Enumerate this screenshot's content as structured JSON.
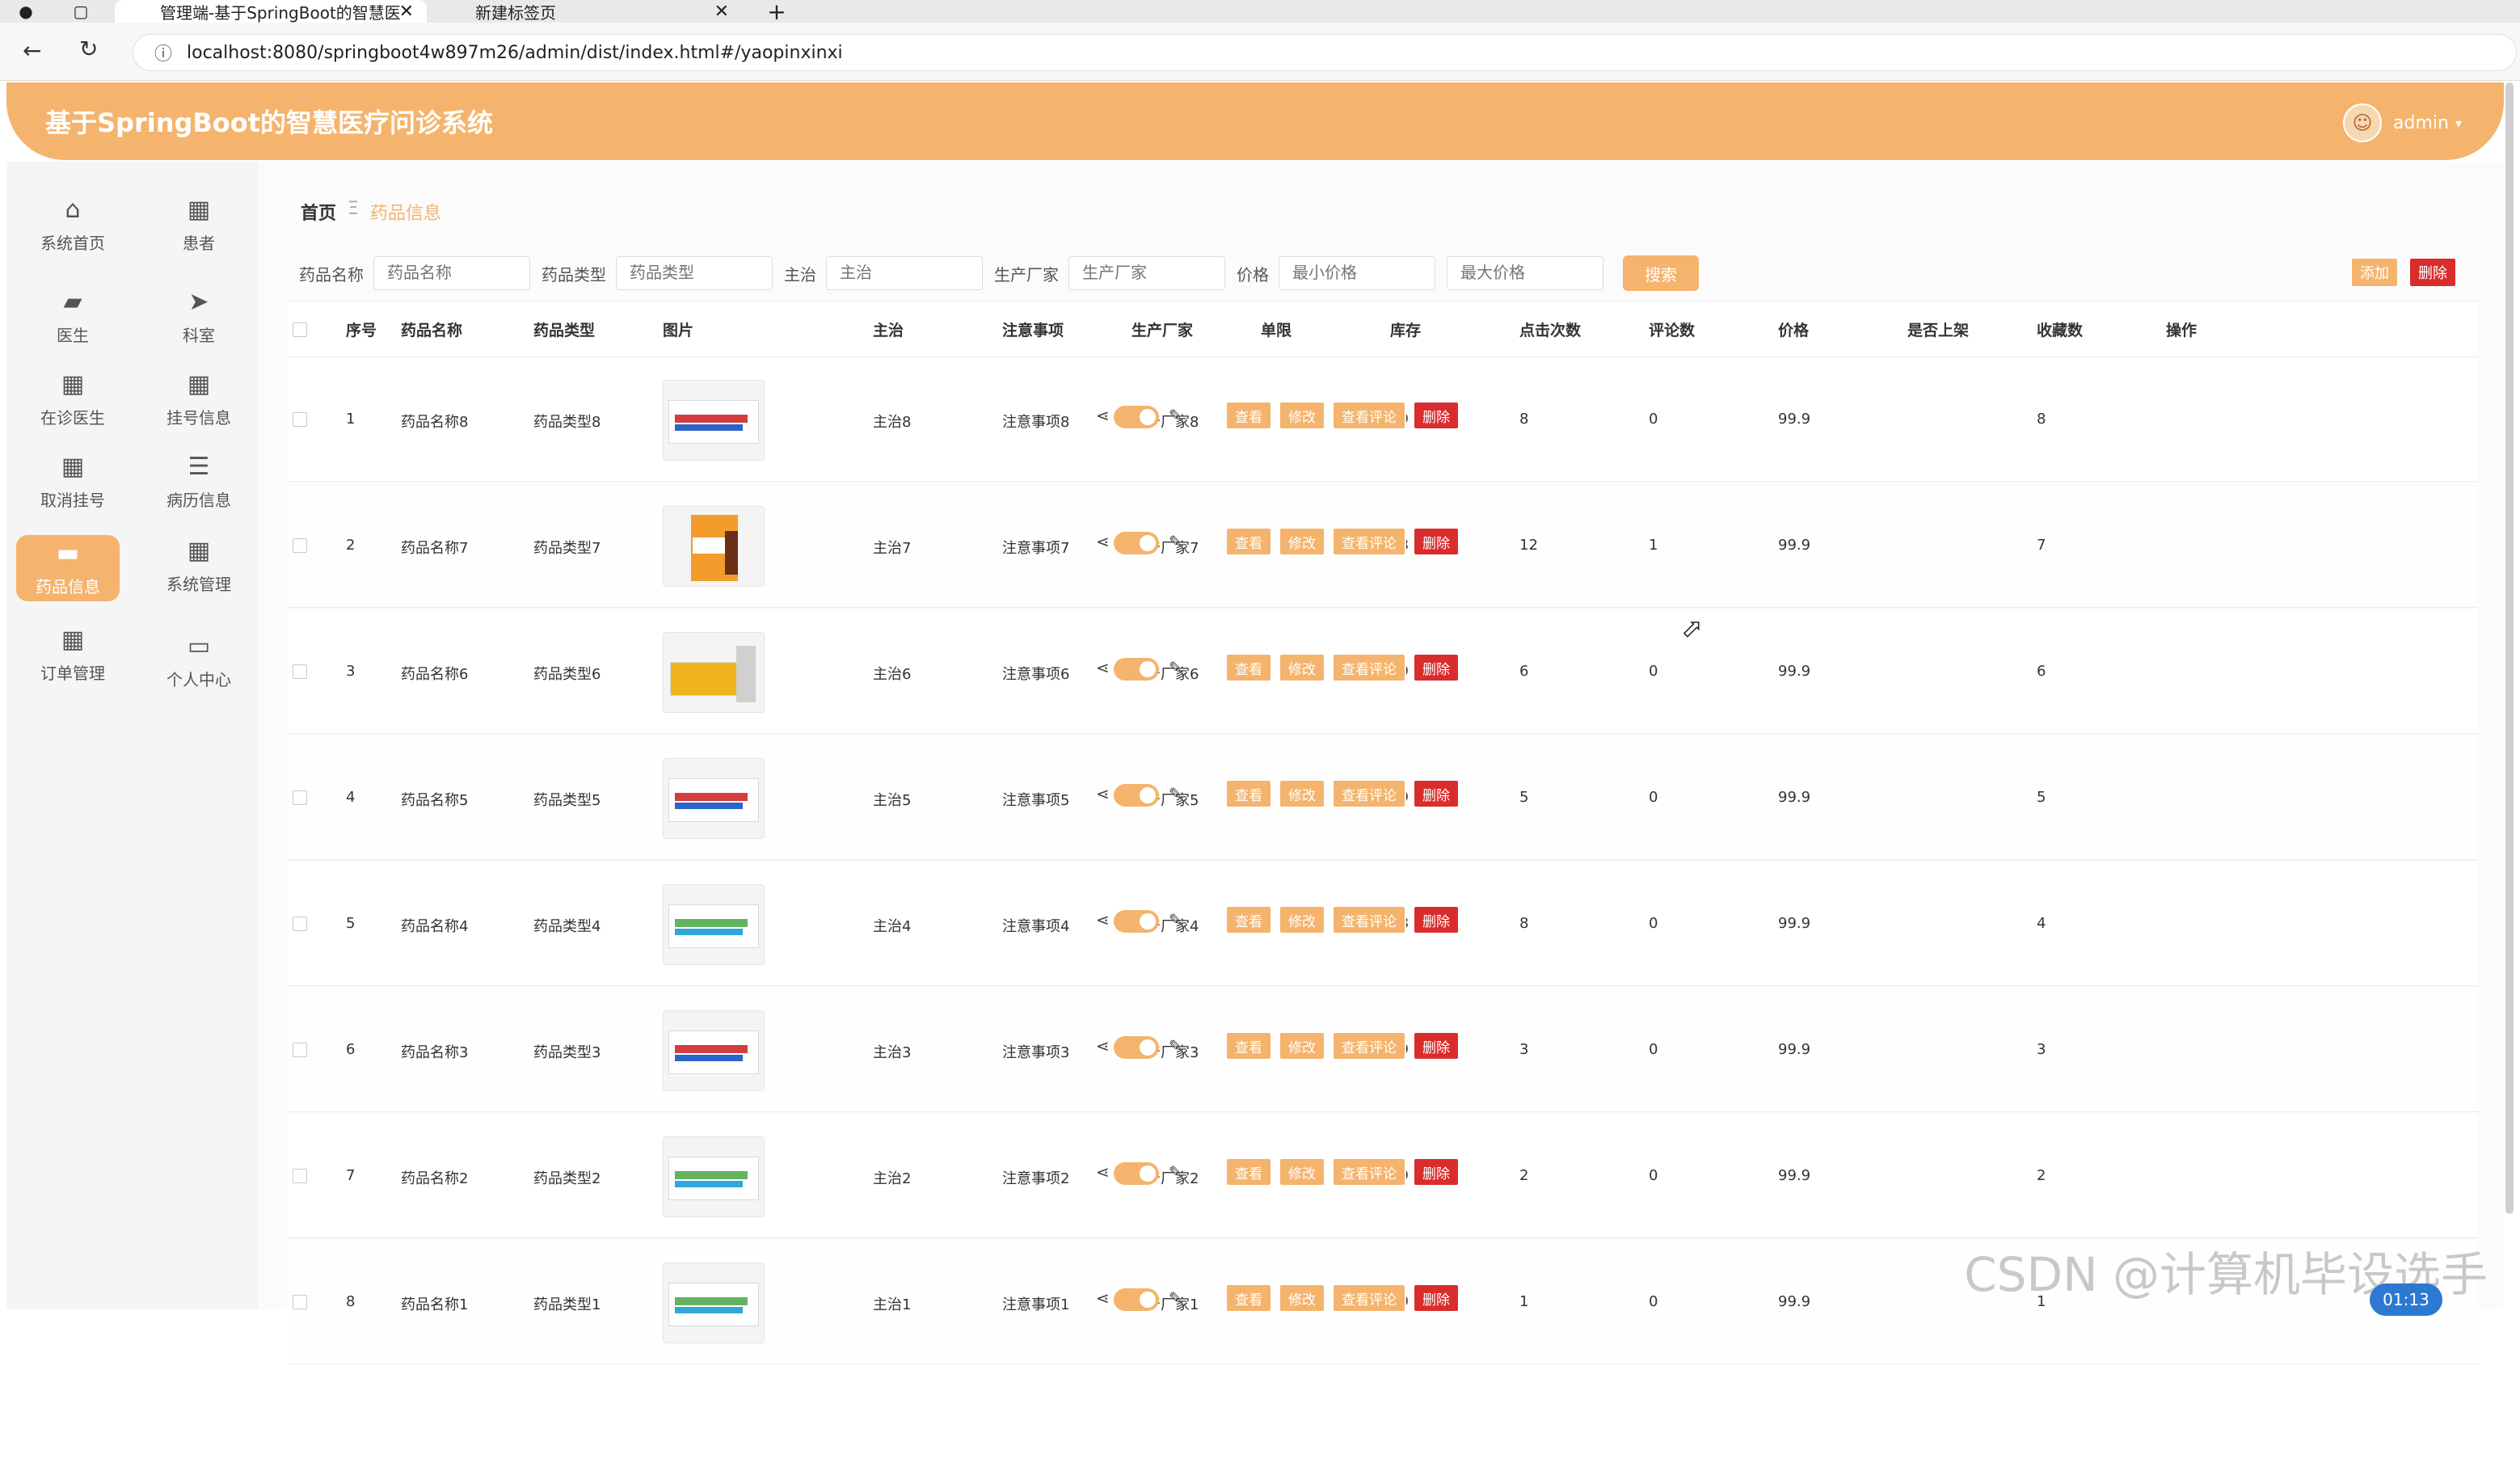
{
  "browser": {
    "tabs": [
      {
        "label": "管理端-基于SpringBoot的智慧医"
      },
      {
        "label": "新建标签页"
      }
    ],
    "url": "localhost:8080/springboot4w897m26/admin/dist/index.html#/yaopinxinxi"
  },
  "header": {
    "title": "基于SpringBoot的智慧医疗问诊系统",
    "user": "admin"
  },
  "sidebar": {
    "items": [
      {
        "label": "系统首页",
        "icon": "home-icon"
      },
      {
        "label": "患者",
        "icon": "grid-icon"
      },
      {
        "label": "医生",
        "icon": "chat-icon"
      },
      {
        "label": "科室",
        "icon": "send-icon"
      },
      {
        "label": "在诊医生",
        "icon": "grid-icon"
      },
      {
        "label": "挂号信息",
        "icon": "grid-icon"
      },
      {
        "label": "取消挂号",
        "icon": "grid-icon"
      },
      {
        "label": "病历信息",
        "icon": "list-icon"
      },
      {
        "label": "药品信息",
        "icon": "monitor-icon"
      },
      {
        "label": "系统管理",
        "icon": "grid-icon"
      },
      {
        "label": "订单管理",
        "icon": "grid-icon"
      },
      {
        "label": "个人中心",
        "icon": "card-icon"
      }
    ]
  },
  "breadcrumb": {
    "home": "首页",
    "separator": "Ξ",
    "current": "药品信息"
  },
  "search": {
    "name_label": "药品名称",
    "name_placeholder": "药品名称",
    "type_label": "药品类型",
    "type_placeholder": "药品类型",
    "main_label": "主治",
    "main_placeholder": "主治",
    "maker_label": "生产厂家",
    "maker_placeholder": "生产厂家",
    "price_label": "价格",
    "min_price_placeholder": "最小价格",
    "max_price_placeholder": "最大价格",
    "search_button": "搜索"
  },
  "top_actions": {
    "add": "添加",
    "delete": "删除"
  },
  "table": {
    "headers": [
      "序号",
      "药品名称",
      "药品类型",
      "图片",
      "主治",
      "注意事项",
      "生产厂家",
      "单限",
      "库存",
      "点击次数",
      "评论数",
      "价格",
      "是否上架",
      "收藏数",
      "操作"
    ],
    "rows": [
      {
        "no": "1",
        "name": "药品名称8",
        "type": "药品类型8",
        "main": "主治8",
        "note": "注意事项8",
        "maker": "生产厂家8",
        "limit": "8",
        "stock": "99",
        "clicks": "8",
        "comments": "0",
        "price": "99.9",
        "fav": "8",
        "img": "box"
      },
      {
        "no": "2",
        "name": "药品名称7",
        "type": "药品类型7",
        "main": "主治7",
        "note": "注意事项7",
        "maker": "生产厂家7",
        "limit": "7",
        "stock": "98",
        "clicks": "12",
        "comments": "1",
        "price": "99.9",
        "fav": "7",
        "img": "bottle"
      },
      {
        "no": "3",
        "name": "药品名称6",
        "type": "药品类型6",
        "main": "主治6",
        "note": "注意事项6",
        "maker": "生产厂家6",
        "limit": "6",
        "stock": "99",
        "clicks": "6",
        "comments": "0",
        "price": "99.9",
        "fav": "6",
        "img": "pill"
      },
      {
        "no": "4",
        "name": "药品名称5",
        "type": "药品类型5",
        "main": "主治5",
        "note": "注意事项5",
        "maker": "生产厂家5",
        "limit": "5",
        "stock": "99",
        "clicks": "5",
        "comments": "0",
        "price": "99.9",
        "fav": "5",
        "img": "box"
      },
      {
        "no": "5",
        "name": "药品名称4",
        "type": "药品类型4",
        "main": "主治4",
        "note": "注意事项4",
        "maker": "生产厂家4",
        "limit": "4",
        "stock": "98",
        "clicks": "8",
        "comments": "0",
        "price": "99.9",
        "fav": "4",
        "img": "green"
      },
      {
        "no": "6",
        "name": "药品名称3",
        "type": "药品类型3",
        "main": "主治3",
        "note": "注意事项3",
        "maker": "生产厂家3",
        "limit": "3",
        "stock": "99",
        "clicks": "3",
        "comments": "0",
        "price": "99.9",
        "fav": "3",
        "img": "box"
      },
      {
        "no": "7",
        "name": "药品名称2",
        "type": "药品类型2",
        "main": "主治2",
        "note": "注意事项2",
        "maker": "生产厂家2",
        "limit": "2",
        "stock": "99",
        "clicks": "2",
        "comments": "0",
        "price": "99.9",
        "fav": "2",
        "img": "green"
      },
      {
        "no": "8",
        "name": "药品名称1",
        "type": "药品类型1",
        "main": "主治1",
        "note": "注意事项1",
        "maker": "生产厂家1",
        "limit": "1",
        "stock": "99",
        "clicks": "1",
        "comments": "0",
        "price": "99.9",
        "fav": "1",
        "img": "green"
      }
    ],
    "row_actions": {
      "view": "查看",
      "edit": "修改",
      "comments": "查看评论",
      "delete": "删除"
    }
  },
  "overlay": {
    "watermark": "CSDN @计算机毕设选手",
    "timer": "01:13"
  },
  "colors": {
    "accent": "#f4b46d",
    "danger": "#d92d2d"
  }
}
